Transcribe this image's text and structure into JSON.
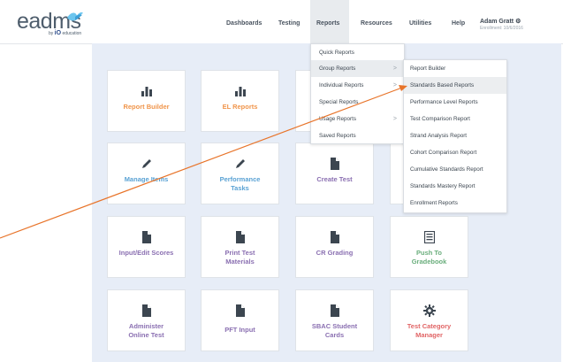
{
  "header": {
    "logo_word": "eadms",
    "logo_by": "by",
    "logo_io": "iO",
    "logo_sub": "education",
    "nav": {
      "dashboards": "Dashboards",
      "testing": "Testing",
      "reports": "Reports",
      "resources": "Resources",
      "utilities": "Utilities",
      "help": "Help"
    },
    "user_name": "Adam Gratt",
    "user_icon": "gear-icon",
    "enrollment": "Enrollment: 10/6/2016"
  },
  "tiles": [
    {
      "label": "Report Builder",
      "icon": "bar-chart-icon",
      "color": "#f0954b"
    },
    {
      "label": "EL Reports",
      "icon": "bar-chart-icon",
      "color": "#f0954b"
    },
    {
      "label": "Manage Items",
      "icon": "pencil-icon",
      "color": "#5aa2d4"
    },
    {
      "label": "Performance Tasks",
      "icon": "pencil-icon",
      "color": "#5aa2d4"
    },
    {
      "label": "Create Test",
      "icon": "document-icon",
      "color": "#8a6fb1"
    },
    {
      "label": "Input/Edit Scores",
      "icon": "document-icon",
      "color": "#8a6fb1"
    },
    {
      "label": "Print Test Materials",
      "icon": "document-icon",
      "color": "#8a6fb1"
    },
    {
      "label": "CR Grading",
      "icon": "document-icon",
      "color": "#8a6fb1"
    },
    {
      "label": "Push To Gradebook",
      "icon": "gradebook-icon",
      "color": "#6aae7c"
    },
    {
      "label": "Administer Online Test",
      "icon": "document-icon",
      "color": "#8a6fb1"
    },
    {
      "label": "PFT Input",
      "icon": "document-icon",
      "color": "#8a6fb1"
    },
    {
      "label": "SBAC Student Cards",
      "icon": "document-icon",
      "color": "#8a6fb1"
    },
    {
      "label": "Test Category Manager",
      "icon": "gear-icon",
      "color": "#e16566"
    }
  ],
  "reports_menu": [
    {
      "label": "Quick Reports",
      "has_sub": false
    },
    {
      "label": "Group Reports",
      "has_sub": true,
      "chevron": ">"
    },
    {
      "label": "Individual Reports",
      "has_sub": true,
      "chevron": ">"
    },
    {
      "label": "Special Reports",
      "has_sub": false
    },
    {
      "label": "Usage Reports",
      "has_sub": true,
      "chevron": ">"
    },
    {
      "label": "Saved Reports",
      "has_sub": false
    }
  ],
  "group_submenu": [
    {
      "label": "Report Builder"
    },
    {
      "label": "Standards Based Reports"
    },
    {
      "label": "Performance Level Reports"
    },
    {
      "label": "Test Comparison Report"
    },
    {
      "label": "Strand Analysis Report"
    },
    {
      "label": "Cohort Comparison Report"
    },
    {
      "label": "Cumulative Standards Report"
    },
    {
      "label": "Standards Mastery Report"
    },
    {
      "label": "Enrollment Reports"
    }
  ],
  "colors": {
    "background": "#e7edf7",
    "accent_arrow": "#e8742a"
  }
}
